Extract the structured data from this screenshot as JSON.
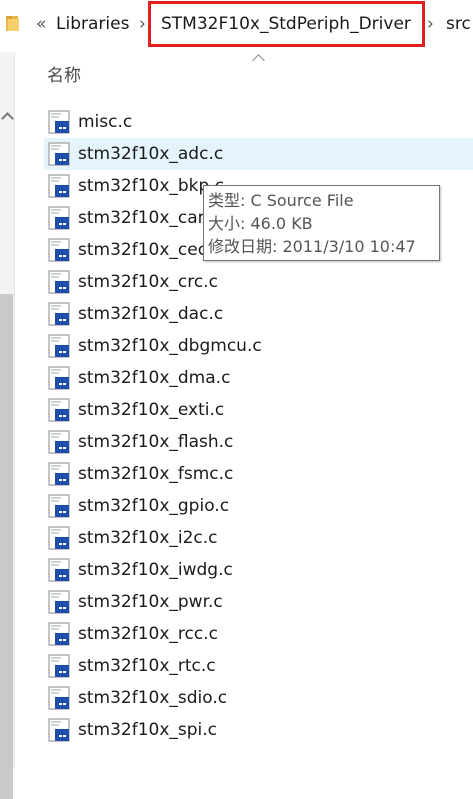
{
  "breadcrumb": {
    "overflow": "«",
    "items": [
      "Libraries",
      "STM32F10x_StdPeriph_Driver",
      "src"
    ],
    "separator": "›"
  },
  "list": {
    "column_name": "名称",
    "files": [
      "misc.c",
      "stm32f10x_adc.c",
      "stm32f10x_bkp.c",
      "stm32f10x_can.c",
      "stm32f10x_cec.c",
      "stm32f10x_crc.c",
      "stm32f10x_dac.c",
      "stm32f10x_dbgmcu.c",
      "stm32f10x_dma.c",
      "stm32f10x_exti.c",
      "stm32f10x_flash.c",
      "stm32f10x_fsmc.c",
      "stm32f10x_gpio.c",
      "stm32f10x_i2c.c",
      "stm32f10x_iwdg.c",
      "stm32f10x_pwr.c",
      "stm32f10x_rcc.c",
      "stm32f10x_rtc.c",
      "stm32f10x_sdio.c",
      "stm32f10x_spi.c"
    ]
  },
  "tooltip": {
    "type": "类型: C Source File",
    "size": "大小: 46.0 KB",
    "modified": "修改日期: 2011/3/10 10:47"
  },
  "colors": {
    "highlight_border": "#e02020",
    "hover_row": "#e5f3fb",
    "file_icon_blue": "#1f4fa8"
  }
}
